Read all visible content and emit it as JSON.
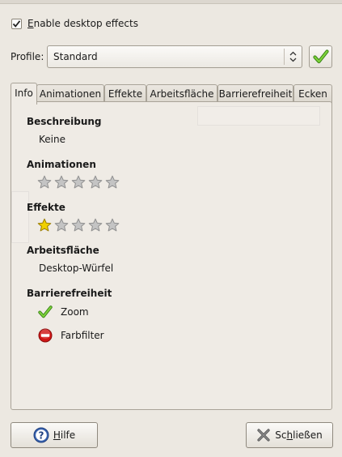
{
  "effects_toggle": {
    "label_mnemonic": "E",
    "label_rest": "nable desktop effects",
    "checked": true
  },
  "profile": {
    "label": "Profile:",
    "value": "Standard",
    "apply_icon": "checkmark-icon"
  },
  "tabs": [
    {
      "label": "Info",
      "active": true
    },
    {
      "label": "Animationen",
      "active": false
    },
    {
      "label": "Effekte",
      "active": false
    },
    {
      "label": "Arbeitsfläche",
      "active": false
    },
    {
      "label": "Barrierefreiheit",
      "active": false
    },
    {
      "label": "Ecken",
      "active": false
    }
  ],
  "info": {
    "description": {
      "heading": "Beschreibung",
      "value": "Keine"
    },
    "animations": {
      "heading": "Animationen",
      "rating": 0,
      "max": 5
    },
    "effects": {
      "heading": "Effekte",
      "rating": 1,
      "max": 5
    },
    "workspace": {
      "heading": "Arbeitsfläche",
      "value": "Desktop-Würfel"
    },
    "accessibility": {
      "heading": "Barrierefreiheit",
      "features": [
        {
          "label": "Zoom",
          "status": "enabled",
          "icon": "checkmark-icon"
        },
        {
          "label": "Farbfilter",
          "status": "disabled",
          "icon": "no-entry-icon"
        }
      ]
    }
  },
  "buttons": {
    "help_mnemonic": "H",
    "help_rest": "ilfe",
    "close_pre": "Sc",
    "close_mnemonic": "h",
    "close_post": "ließen"
  },
  "colors": {
    "active_star": "#f0d000",
    "inactive_star": "#c4c4c4",
    "ok_green": "#4ea21a",
    "stop_red": "#d01515"
  }
}
